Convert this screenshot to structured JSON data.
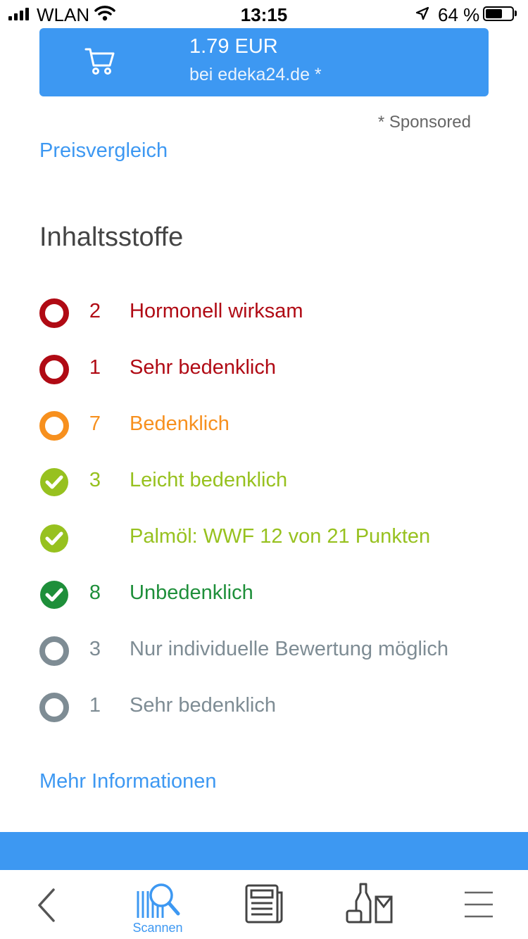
{
  "status_bar": {
    "carrier": "WLAN",
    "time": "13:15",
    "battery_percent": "64 %",
    "battery_level": 0.64
  },
  "buy_box": {
    "price": "1.79 EUR",
    "shop": "bei edeka24.de *",
    "icon": "cart-icon",
    "color": "#3d98f2"
  },
  "sponsored_note": "* Sponsored",
  "price_compare_link": "Preisvergleich",
  "ingredients": {
    "title": "Inhaltsstoffe",
    "rows": [
      {
        "count": "2",
        "label": "Hormonell wirksam",
        "icon": "red-ring-icon",
        "color": "#b00a14"
      },
      {
        "count": "1",
        "label": "Sehr bedenklich",
        "icon": "red-ring-icon",
        "color": "#b00a14"
      },
      {
        "count": "7",
        "label": "Bedenklich",
        "icon": "orange-ring-icon",
        "color": "#f7901e"
      },
      {
        "count": "3",
        "label": "Leicht bedenklich",
        "icon": "light-green-check-icon",
        "color": "#97c11f"
      },
      {
        "count": "",
        "label": "Palmöl: WWF 12 von 21 Punkten",
        "icon": "light-green-check-icon",
        "color": "#97c11f"
      },
      {
        "count": "8",
        "label": "Unbedenklich",
        "icon": "dark-green-check-icon",
        "color": "#1e8f3a"
      },
      {
        "count": "3",
        "label": "Nur individuelle Bewertung möglich",
        "icon": "grey-ring-icon",
        "color": "#7e8c94"
      },
      {
        "count": "1",
        "label": "Sehr bedenklich",
        "icon": "grey-ring-icon",
        "color": "#7e8c94"
      }
    ]
  },
  "more_info_link": "Mehr Informationen",
  "tab_bar": {
    "back": {
      "icon": "back-chevron-icon"
    },
    "scan": {
      "label": "Scannen",
      "icon": "barcode-search-icon",
      "active": true
    },
    "news": {
      "icon": "newspaper-icon"
    },
    "products": {
      "icon": "products-icon"
    },
    "menu": {
      "icon": "menu-icon"
    }
  }
}
